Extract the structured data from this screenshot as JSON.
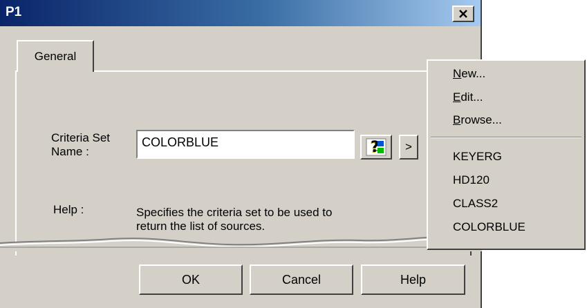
{
  "window": {
    "title": "P1"
  },
  "tabs": [
    {
      "label": "General"
    }
  ],
  "form": {
    "criteria_label_line1": "Criteria Set",
    "criteria_label_line2": "Name :",
    "criteria_value": "COLORBLUE",
    "help_label": "Help :",
    "help_text_line1": "Specifies the criteria set to be used to",
    "help_text_line2": "return the list of sources."
  },
  "icons": {
    "close": "close-icon",
    "query": "query-help-icon",
    "arrow": "arrow-right-icon"
  },
  "small_buttons": {
    "arrow_label": ">"
  },
  "buttons": {
    "ok": "OK",
    "cancel": "Cancel",
    "help": "Help"
  },
  "menu": {
    "actions": [
      {
        "accel": "N",
        "rest": "ew..."
      },
      {
        "accel": "E",
        "rest": "dit..."
      },
      {
        "accel": "B",
        "rest": "rowse..."
      }
    ],
    "recent": [
      "KEYERG",
      "HD120",
      "CLASS2",
      "COLORBLUE"
    ]
  },
  "colors": {
    "face": "#d4d0c8",
    "title_start": "#0a246a",
    "title_end": "#a6caf0"
  }
}
